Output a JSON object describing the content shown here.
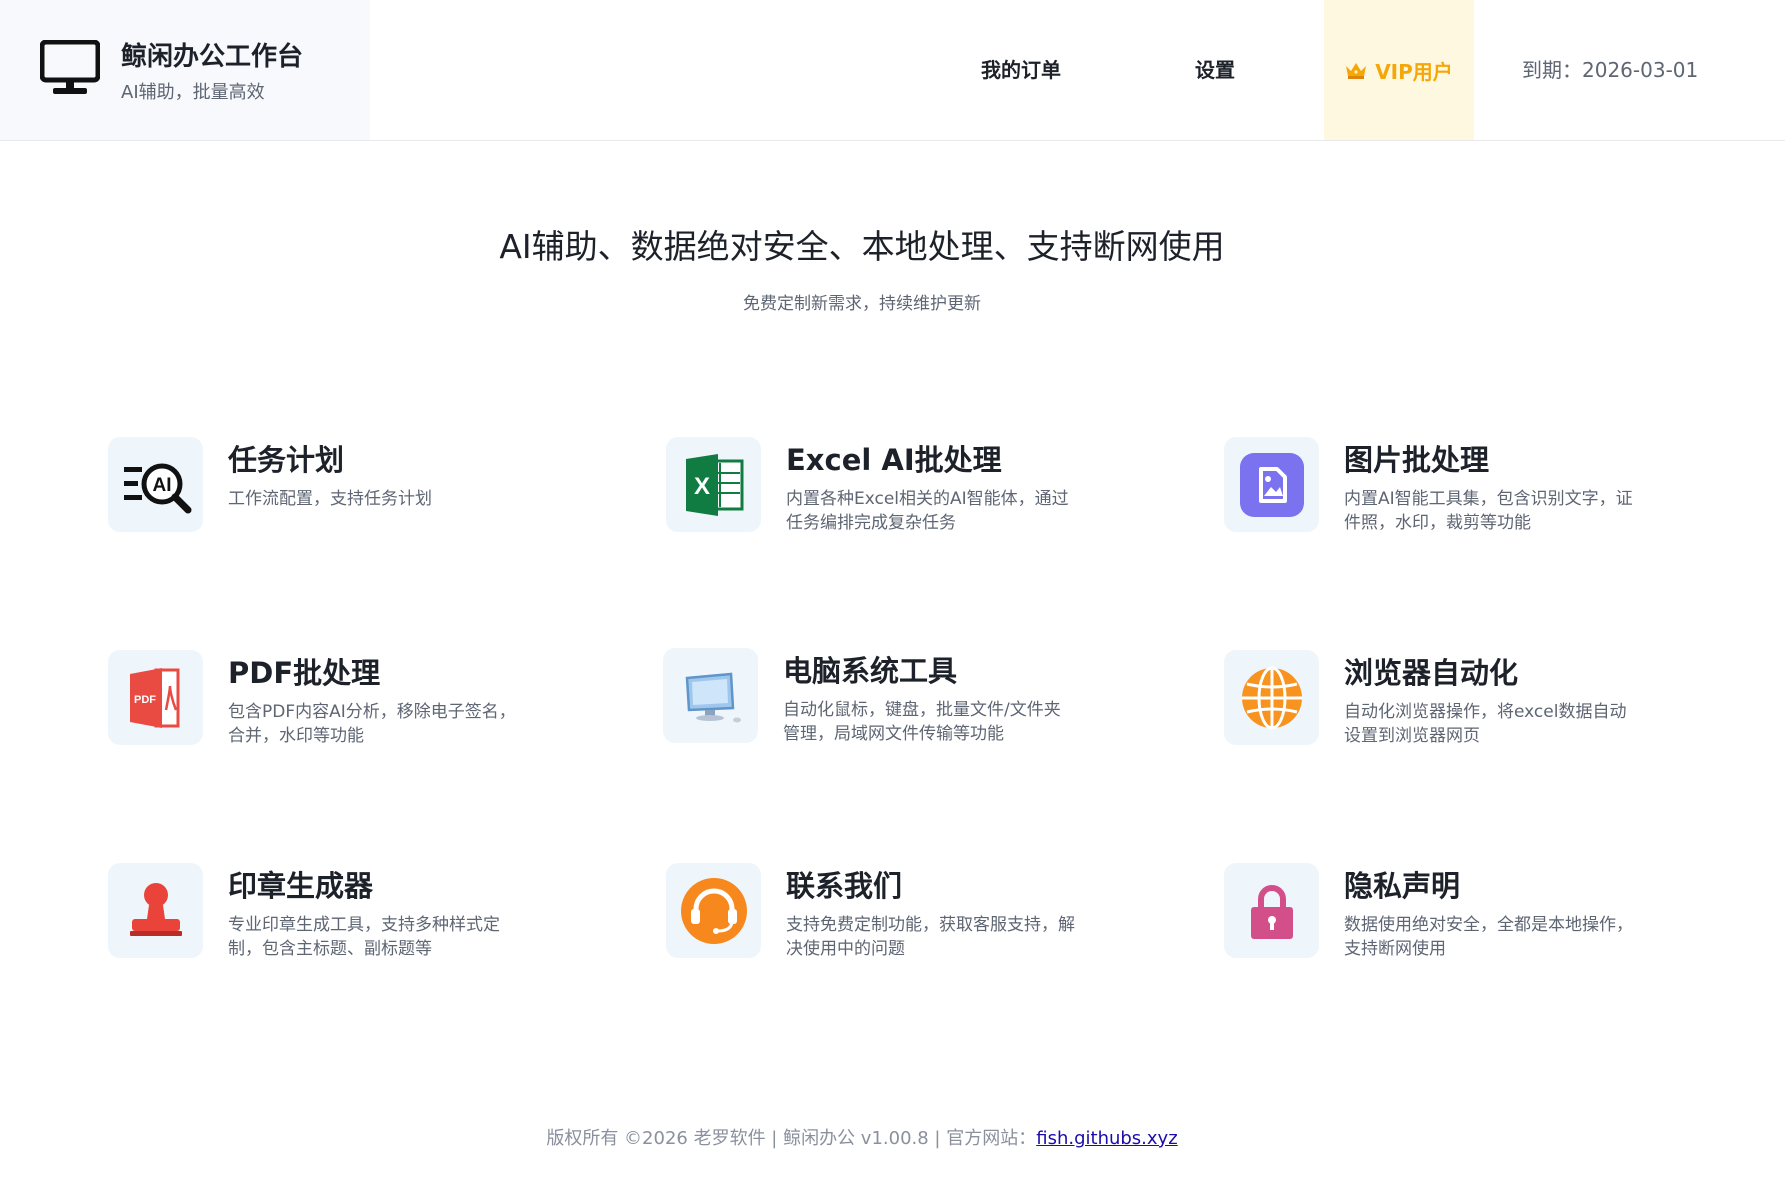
{
  "header": {
    "brand_title": "鲸闲办公工作台",
    "brand_subtitle": "AI辅助，批量高效",
    "nav": {
      "orders": "我的订单",
      "settings": "设置"
    },
    "vip_label": "VIP用户",
    "expiry": "到期：2026-03-01"
  },
  "hero": {
    "title": "AI辅助、数据绝对安全、本地处理、支持断网使用",
    "subtitle": "免费定制新需求，持续维护更新"
  },
  "features": [
    {
      "title": "任务计划",
      "desc": "工作流配置，支持任务计划",
      "icon": "ai-search-icon"
    },
    {
      "title": "Excel AI批处理",
      "desc": "内置各种Excel相关的AI智能体，通过任务编排完成复杂任务",
      "icon": "excel-icon"
    },
    {
      "title": "图片批处理",
      "desc": "内置AI智能工具集，包含识别文字，证件照，水印，裁剪等功能",
      "icon": "image-icon"
    },
    {
      "title": "PDF批处理",
      "desc": "包含PDF内容AI分析，移除电子签名，合并，水印等功能",
      "icon": "pdf-icon"
    },
    {
      "title": "电脑系统工具",
      "desc": "自动化鼠标，键盘，批量文件/文件夹管理，局域网文件传输等功能",
      "icon": "monitor-icon"
    },
    {
      "title": "浏览器自动化",
      "desc": "自动化浏览器操作，将excel数据自动设置到浏览器网页",
      "icon": "globe-icon"
    },
    {
      "title": "印章生成器",
      "desc": "专业印章生成工具，支持多种样式定制，包含主标题、副标题等",
      "icon": "stamp-icon"
    },
    {
      "title": "联系我们",
      "desc": "支持免费定制功能，获取客服支持，解决使用中的问题",
      "icon": "headset-icon"
    },
    {
      "title": "隐私声明",
      "desc": "数据使用绝对安全，全都是本地操作，支持断网使用",
      "icon": "lock-icon"
    }
  ],
  "footer": {
    "copyright": "版权所有 ©2026 老罗软件 | 鲸闲办公 v1.00.8 | 官方网站：",
    "site_link": "fish.githubs.xyz"
  },
  "colors": {
    "vip_accent": "#f5a70a",
    "vip_background": "#fff8e0",
    "link": "#1a0dab",
    "icon_tile": "#eef6fc"
  }
}
